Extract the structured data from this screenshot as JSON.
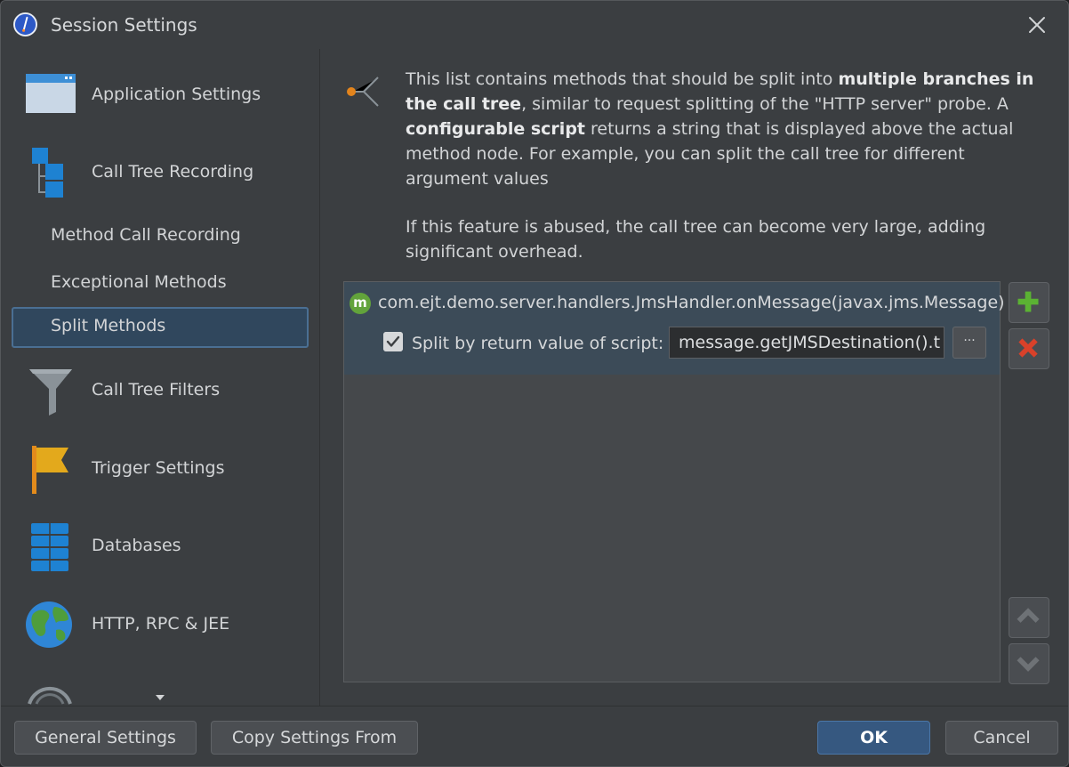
{
  "window": {
    "title": "Session Settings"
  },
  "sidebar": {
    "items": [
      {
        "label": "Application Settings",
        "icon": "application-settings-icon"
      },
      {
        "label": "Call Tree Recording",
        "icon": "call-tree-recording-icon"
      },
      {
        "label": "Method Call Recording"
      },
      {
        "label": "Exceptional Methods"
      },
      {
        "label": "Split Methods",
        "selected": true
      },
      {
        "label": "Call Tree Filters",
        "icon": "funnel-icon"
      },
      {
        "label": "Trigger Settings",
        "icon": "flag-icon"
      },
      {
        "label": "Databases",
        "icon": "database-icon"
      },
      {
        "label": "HTTP, RPC & JEE",
        "icon": "globe-icon"
      }
    ]
  },
  "description": {
    "p1_a": "This list contains methods that should be split into ",
    "p1_b": "multiple branches in the call tree",
    "p1_c": ", similar to request splitting of the \"HTTP server\" probe. A ",
    "p1_d": "configurable script",
    "p1_e": " returns a string that is displayed above the actual method node. For example, you can split the call tree for different argument values",
    "p2": "If this feature is abused, the call tree can become very large, adding significant overhead."
  },
  "list": {
    "rows": [
      {
        "method_icon": "m",
        "method": "com.ejt.demo.server.handlers.JmsHandler.onMessage(javax.jms.Message)",
        "split_checked": true,
        "split_label": "Split by return value of script:",
        "script_value": "message.getJMSDestination().t",
        "ellipsis": "···"
      }
    ]
  },
  "footer": {
    "general_settings": "General Settings",
    "copy_settings_from": "Copy Settings From",
    "ok": "OK",
    "cancel": "Cancel"
  },
  "colors": {
    "background": "#3b3e41",
    "selection": "#30475d",
    "accent": "#365880",
    "add_green": "#5bb233",
    "remove_red": "#d9412a"
  }
}
